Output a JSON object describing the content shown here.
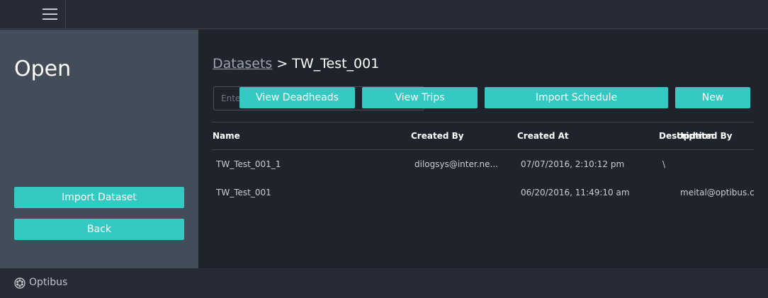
{
  "sidebar": {
    "title": "Open",
    "import_button": "Import Dataset",
    "back_button": "Back"
  },
  "breadcrumb": {
    "root": "Datasets",
    "separator": ">",
    "current": "TW_Test_001"
  },
  "search": {
    "placeholder": "Ente"
  },
  "toolbar": {
    "view_deadheads": "View Deadheads",
    "view_trips": "View Trips",
    "import_schedule": "Import Schedule",
    "new": "New"
  },
  "table": {
    "headers": {
      "name": "Name",
      "created_by": "Created By",
      "created_at": "Created At",
      "description": "Description",
      "updated_by": "Updated By"
    },
    "rows": [
      {
        "name": "TW_Test_001_1",
        "created_by": "dilogsys@inter.ne...",
        "created_at": "07/07/2016, 2:10:12 pm",
        "description": "\\",
        "updated_by": ""
      },
      {
        "name": "TW_Test_001",
        "created_by": "",
        "created_at": "06/20/2016, 11:49:10 am",
        "description": "",
        "updated_by": "meital@optibus.c"
      }
    ]
  },
  "footer": {
    "brand": "Optibus",
    "icon": "optibus-logo-icon"
  },
  "colors": {
    "accent": "#35c9c3",
    "topbar": "#262b35",
    "sidebar": "#434d5a",
    "main": "#1f232b"
  }
}
